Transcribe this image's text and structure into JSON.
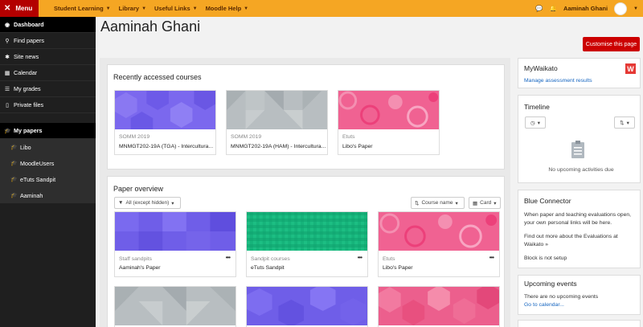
{
  "topbar": {
    "menu_label": "Menu",
    "nav": [
      {
        "label": "Student Learning"
      },
      {
        "label": "Library"
      },
      {
        "label": "Useful Links"
      },
      {
        "label": "Moodle Help"
      }
    ],
    "user_name": "Aaminah Ghani",
    "accent": "#f5a623",
    "menu_color": "#b30000"
  },
  "sidebar": {
    "items": [
      {
        "label": "Dashboard",
        "icon": "dashboard-icon"
      },
      {
        "label": "Find papers",
        "icon": "search-icon"
      },
      {
        "label": "Site news",
        "icon": "news-icon"
      },
      {
        "label": "Calendar",
        "icon": "calendar-icon"
      },
      {
        "label": "My grades",
        "icon": "grades-icon"
      },
      {
        "label": "Private files",
        "icon": "file-icon"
      }
    ],
    "group": {
      "label": "My papers",
      "icon": "graduation-cap-icon"
    },
    "sub_items": [
      {
        "label": "Libo"
      },
      {
        "label": "MoodleUsers"
      },
      {
        "label": "eTuts Sandpit"
      },
      {
        "label": "Aaminah"
      }
    ]
  },
  "page": {
    "title": "Aaminah Ghani",
    "customise_label": "Customise this page"
  },
  "recent": {
    "title": "Recently accessed courses",
    "courses": [
      {
        "category": "SOMM 2019",
        "name": "MNMGT202-19A (TGA) - Intercultura...",
        "color": "#7b68ee"
      },
      {
        "category": "SOMM 2019",
        "name": "MNMGT202-19A (HAM) - Intercultura...",
        "color": "#b8bec1"
      },
      {
        "category": "Etuts",
        "name": "Libo's Paper",
        "color": "#f06292"
      }
    ]
  },
  "overview": {
    "title": "Paper overview",
    "filter_label": "All (except hidden)",
    "sort_label": "Course name",
    "view_label": "Card",
    "papers": [
      {
        "category": "Staff sandpits",
        "name": "Aaminah's Paper",
        "color": "#6f5ee8"
      },
      {
        "category": "Sandpit courses",
        "name": "eTuts Sandpit",
        "color": "#16b37a"
      },
      {
        "category": "Etuts",
        "name": "Libo's Paper",
        "color": "#f06292"
      }
    ],
    "papers_row2": [
      {
        "color": "#b8bec1"
      },
      {
        "color": "#6f5ee8"
      },
      {
        "color": "#ec5f8d"
      }
    ]
  },
  "right": {
    "mywaikato": {
      "title": "MyWaikato",
      "link": "Manage assessment results",
      "logo": "W"
    },
    "timeline": {
      "title": "Timeline",
      "empty": "No upcoming activities due"
    },
    "blue": {
      "title": "Blue Connector",
      "text1": "When paper and teaching evaluations open, your own personal links will be here.",
      "text2": "Find out more about the Evaluations at Waikato »",
      "text3": "Block is not setup"
    },
    "events": {
      "title": "Upcoming events",
      "text": "There are no upcoming events",
      "link": "Go to calendar..."
    }
  }
}
